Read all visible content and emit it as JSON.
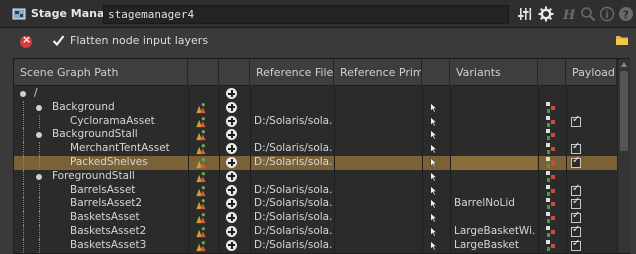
{
  "titlebar": {
    "title": "Stage Manager",
    "node_name": "stagemanager4",
    "icons": [
      "stage-manager-icon",
      "pin-tools-icon",
      "gear-icon",
      "help-h-icon",
      "search-icon",
      "info-icon",
      "help-icon"
    ]
  },
  "options": {
    "flatten_label": "Flatten node input layers",
    "flatten_checked": true
  },
  "table": {
    "columns": [
      "Scene Graph Path",
      "",
      "",
      "Reference File",
      "Reference Primit",
      "",
      "Variants",
      "",
      "Payload"
    ],
    "rows": [
      {
        "name": "/",
        "depth": 0,
        "expander": true,
        "has_asset_icon": false,
        "has_plus": true,
        "file": "",
        "variant": "",
        "payload_icon": false,
        "payload": null,
        "selected": false
      },
      {
        "name": "Background",
        "depth": 1,
        "expander": true,
        "has_asset_icon": true,
        "has_plus": true,
        "file": "",
        "variant": "",
        "payload_icon": false,
        "payload": null,
        "selected": false
      },
      {
        "name": "CycloramaAsset",
        "depth": 2,
        "expander": false,
        "has_asset_icon": true,
        "has_plus": true,
        "file": "D:/Solaris/sola...",
        "variant": "",
        "payload_icon": true,
        "payload": true,
        "selected": false
      },
      {
        "name": "BackgroundStall",
        "depth": 1,
        "expander": true,
        "has_asset_icon": true,
        "has_plus": true,
        "file": "",
        "variant": "",
        "payload_icon": false,
        "payload": null,
        "selected": false
      },
      {
        "name": "MerchantTentAsset",
        "depth": 2,
        "expander": false,
        "has_asset_icon": true,
        "has_plus": true,
        "file": "D:/Solaris/sola...",
        "variant": "",
        "payload_icon": true,
        "payload": true,
        "selected": false
      },
      {
        "name": "PackedShelves",
        "depth": 2,
        "expander": false,
        "has_asset_icon": true,
        "has_plus": true,
        "file": "D:/Solaris/sola...",
        "variant": "",
        "payload_icon": true,
        "payload": true,
        "selected": true
      },
      {
        "name": "ForegroundStall",
        "depth": 1,
        "expander": true,
        "has_asset_icon": true,
        "has_plus": true,
        "file": "",
        "variant": "",
        "payload_icon": false,
        "payload": null,
        "selected": false
      },
      {
        "name": "BarrelsAsset",
        "depth": 2,
        "expander": false,
        "has_asset_icon": true,
        "has_plus": true,
        "file": "D:/Solaris/sola...",
        "variant": "",
        "payload_icon": true,
        "payload": true,
        "selected": false
      },
      {
        "name": "BarrelsAsset2",
        "depth": 2,
        "expander": false,
        "has_asset_icon": true,
        "has_plus": true,
        "file": "D:/Solaris/sola...",
        "variant": "BarrelNoLid",
        "payload_icon": true,
        "payload": true,
        "selected": false
      },
      {
        "name": "BasketsAsset",
        "depth": 2,
        "expander": false,
        "has_asset_icon": true,
        "has_plus": true,
        "file": "D:/Solaris/sola...",
        "variant": "",
        "payload_icon": true,
        "payload": true,
        "selected": false
      },
      {
        "name": "BasketsAsset2",
        "depth": 2,
        "expander": false,
        "has_asset_icon": true,
        "has_plus": true,
        "file": "D:/Solaris/sola...",
        "variant": "LargeBasketWi...",
        "payload_icon": true,
        "payload": true,
        "selected": false
      },
      {
        "name": "BasketsAsset3",
        "depth": 2,
        "expander": false,
        "has_asset_icon": true,
        "has_plus": true,
        "file": "D:/Solaris/sola...",
        "variant": "LargeBasket",
        "payload_icon": true,
        "payload": true,
        "selected": false
      }
    ]
  },
  "colors": {
    "selection": "#7a6136",
    "close_red": "#d83c3c",
    "plus_green": "#3fae49"
  }
}
